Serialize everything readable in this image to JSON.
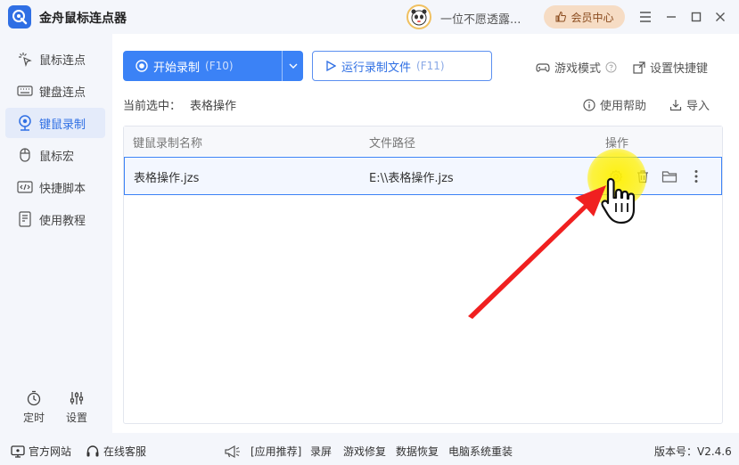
{
  "app": {
    "title": "金舟鼠标连点器"
  },
  "user": {
    "name": "一位不愿透露..."
  },
  "vip": {
    "label": "会员中心"
  },
  "sidebar": {
    "items": [
      {
        "label": "鼠标连点",
        "icon": "click-icon"
      },
      {
        "label": "键盘连点",
        "icon": "keyboard-icon"
      },
      {
        "label": "键鼠录制",
        "icon": "webcam-icon",
        "active": true
      },
      {
        "label": "鼠标宏",
        "icon": "mouse-icon"
      },
      {
        "label": "快捷脚本",
        "icon": "script-icon"
      },
      {
        "label": "使用教程",
        "icon": "tutorial-icon"
      }
    ],
    "tools": [
      {
        "label": "定时",
        "icon": "timer-icon"
      },
      {
        "label": "设置",
        "icon": "sliders-icon"
      }
    ]
  },
  "toolbar": {
    "start_label": "开始录制",
    "start_hotkey": "(F10)",
    "run_label": "运行录制文件",
    "run_hotkey": "(F11)",
    "game_mode": "游戏模式",
    "shortcut": "设置快捷键"
  },
  "current": {
    "label": "当前选中：",
    "value": "表格操作"
  },
  "links": {
    "help": "使用帮助",
    "import": "导入"
  },
  "table": {
    "headers": [
      "键鼠录制名称",
      "文件路径",
      "操作"
    ],
    "rows": [
      {
        "name": "表格操作.jzs",
        "path": "E:\\\\表格操作.jzs"
      }
    ]
  },
  "footer": {
    "website": "官方网站",
    "support": "在线客服",
    "recommend": "[应用推荐]",
    "rec_items": [
      "录屏",
      "游戏修复",
      "数据恢复",
      "电脑系统重装"
    ],
    "version": "版本号：V2.4.6"
  },
  "colors": {
    "accent": "#3b82f6",
    "highlight": "#fff000",
    "arrow": "#f02020"
  }
}
